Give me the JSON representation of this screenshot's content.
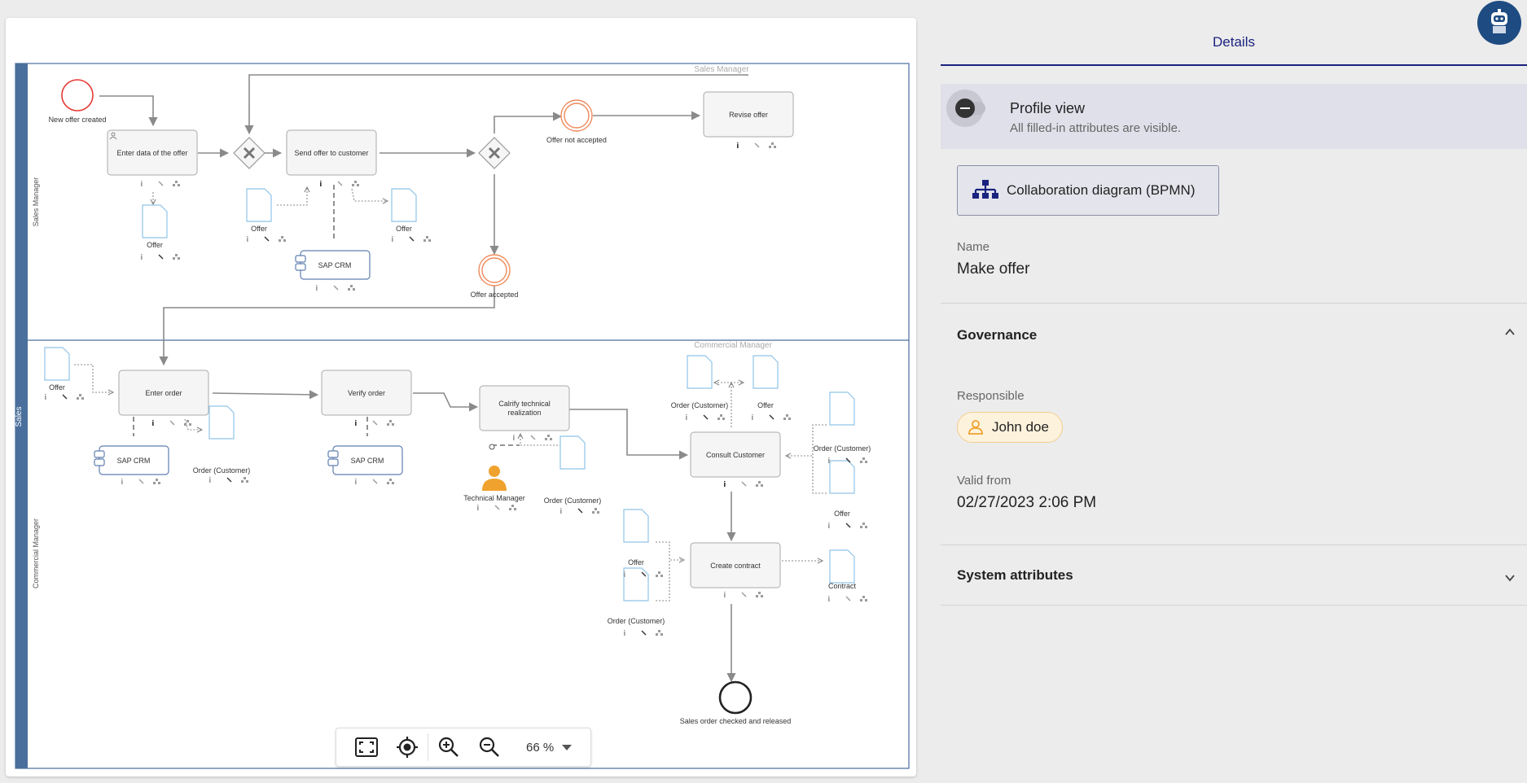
{
  "diagram": {
    "pool_label": "Sales",
    "lanes": [
      {
        "side_label": "Sales Manager",
        "top_label": "Sales Manager"
      },
      {
        "side_label": "Commercial Manager",
        "top_label": "Commercial Manager"
      }
    ],
    "events": {
      "start": "New offer created",
      "not_accepted": "Offer not accepted",
      "accepted": "Offer accepted",
      "end": "Sales order checked and released"
    },
    "tasks": {
      "enter_data": "Enter data of the offer",
      "send_offer": "Send offer to customer",
      "revise_offer": "Revise offer",
      "enter_order": "Enter order",
      "verify_order": "Verify order",
      "clarify_line1": "Calrify technical",
      "clarify_line2": "realization",
      "consult": "Consult Customer",
      "create_contract": "Create contract"
    },
    "documents": {
      "offer": "Offer",
      "order_customer": "Order (Customer)",
      "contract": "Contract"
    },
    "systems": {
      "sap": "SAP CRM"
    },
    "roles": {
      "technical_manager": "Technical Manager"
    }
  },
  "zoom": {
    "level": "66 %"
  },
  "panel": {
    "title": "Details",
    "profile_title": "Profile view",
    "profile_subtitle": "All filled-in attributes are visible.",
    "diagram_button": "Collaboration diagram (BPMN)",
    "name_label": "Name",
    "name_value": "Make offer",
    "governance_title": "Governance",
    "responsible_label": "Responsible",
    "responsible_value": "John doe",
    "valid_from_label": "Valid from",
    "valid_from_value": "02/27/2023 2:06 PM",
    "system_attributes_title": "System attributes"
  },
  "colors": {
    "accent": "#1a237e",
    "pool_bar": "#4a6f9c",
    "start_event": "#e53935",
    "intermediate_event": "#ef8a5b",
    "document_border": "#90c4e8",
    "chip_bg": "#fdf2dc",
    "person": "#f0a22e"
  },
  "icons": [
    "fit-screen-icon",
    "center-target-icon",
    "zoom-in-icon",
    "zoom-out-icon",
    "caret-down-icon",
    "toggle-minus-icon",
    "hierarchy-icon",
    "chevron-up-icon",
    "chevron-down-icon",
    "person-outline-icon",
    "robot-avatar-icon"
  ]
}
